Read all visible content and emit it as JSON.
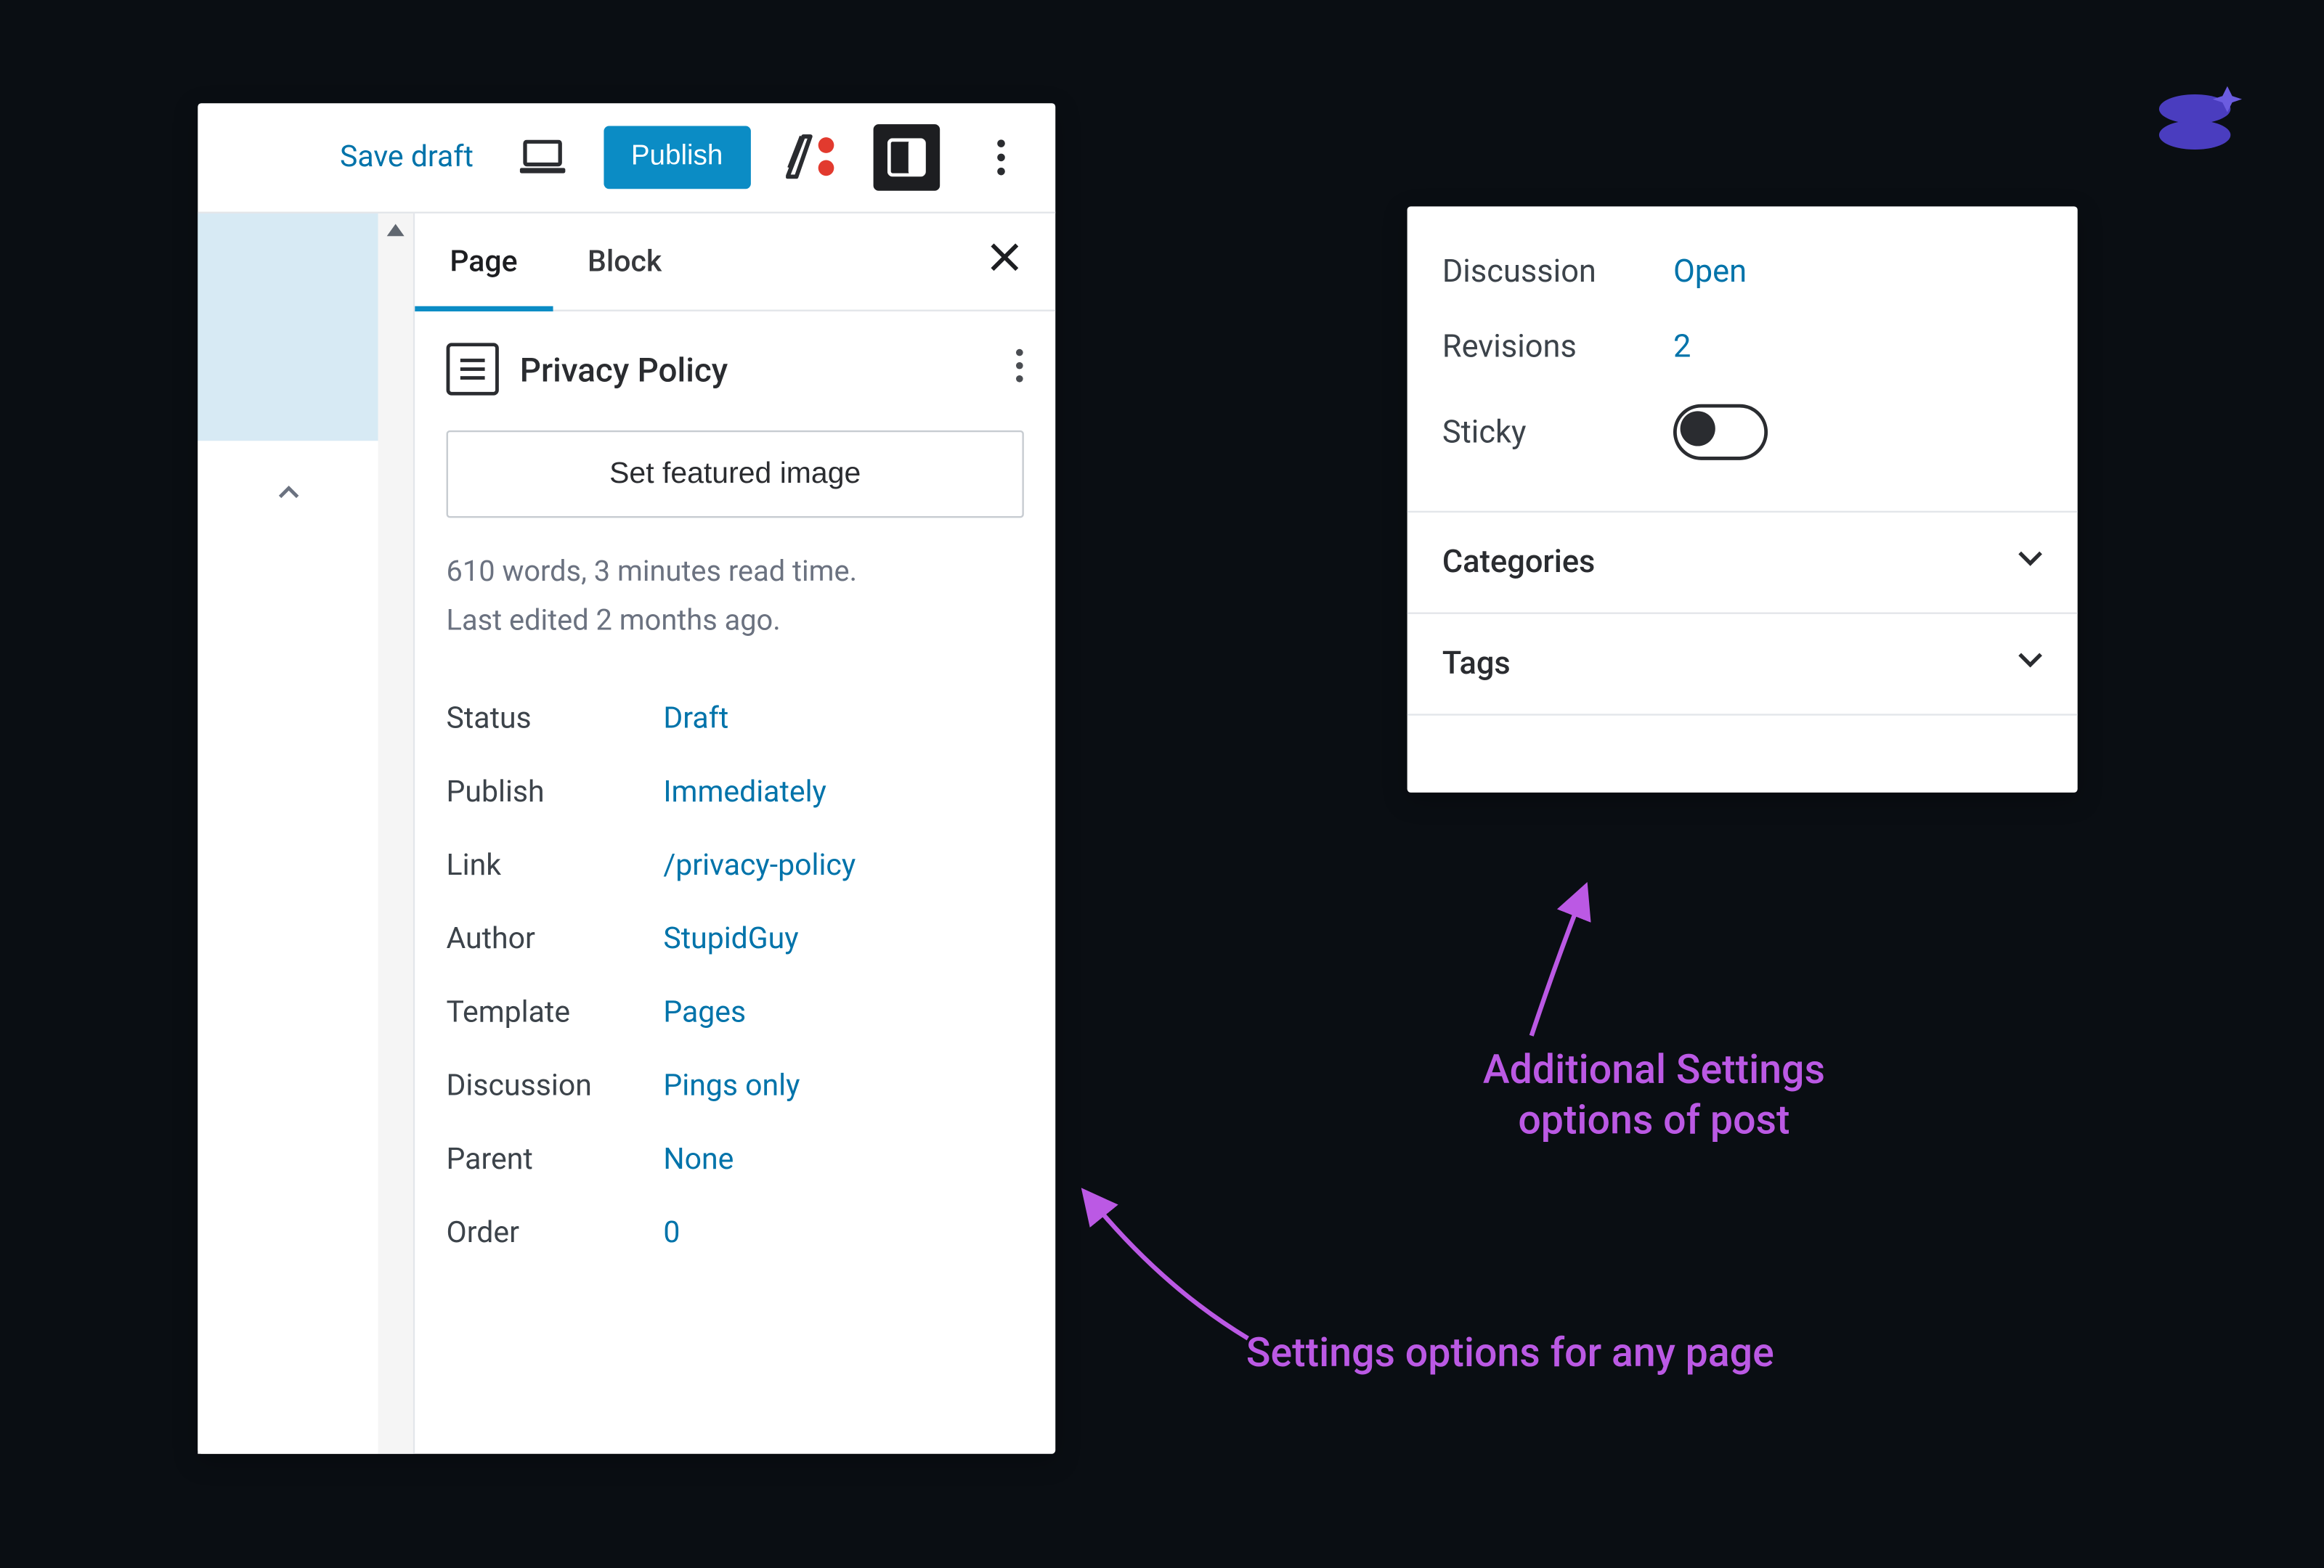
{
  "topbar": {
    "save_draft": "Save draft",
    "publish": "Publish"
  },
  "sidebar": {
    "tabs": {
      "page": "Page",
      "block": "Block"
    },
    "page_title": "Privacy Policy",
    "featured_button": "Set featured image",
    "meta_line_1": "610 words, 3 minutes read time.",
    "meta_line_2": "Last edited 2 months ago.",
    "fields": {
      "status": {
        "label": "Status",
        "value": "Draft"
      },
      "publish": {
        "label": "Publish",
        "value": "Immediately"
      },
      "link": {
        "label": "Link",
        "value": "/privacy-policy"
      },
      "author": {
        "label": "Author",
        "value": "StupidGuy"
      },
      "template": {
        "label": "Template",
        "value": "Pages"
      },
      "discussion": {
        "label": "Discussion",
        "value": "Pings only"
      },
      "parent": {
        "label": "Parent",
        "value": "None"
      },
      "order": {
        "label": "Order",
        "value": "0"
      }
    }
  },
  "post_extras": {
    "discussion": {
      "label": "Discussion",
      "value": "Open"
    },
    "revisions": {
      "label": "Revisions",
      "value": "2"
    },
    "sticky": {
      "label": "Sticky",
      "on": false
    },
    "categories": "Categories",
    "tags": "Tags"
  },
  "annotations": {
    "page_settings": "Settings options for any page",
    "post_settings_l1": "Additional Settings",
    "post_settings_l2": "options of post"
  }
}
